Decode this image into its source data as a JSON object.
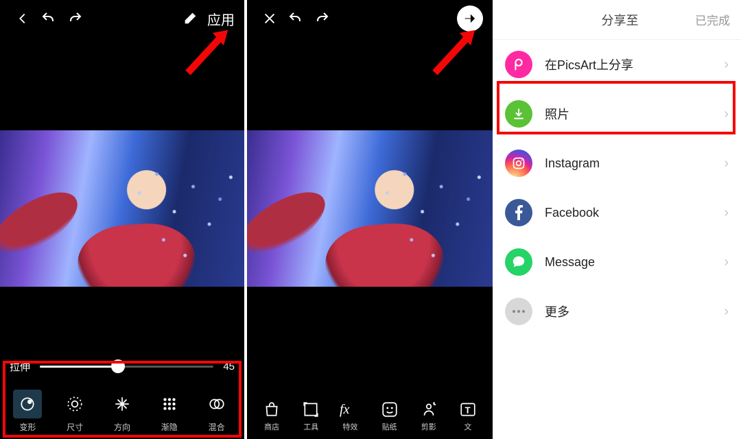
{
  "left": {
    "apply": "应用",
    "slider": {
      "label": "拉伸",
      "value": 45
    },
    "tools": [
      {
        "label": "变形",
        "name": "tool-distort"
      },
      {
        "label": "尺寸",
        "name": "tool-size"
      },
      {
        "label": "方向",
        "name": "tool-direction"
      },
      {
        "label": "渐隐",
        "name": "tool-fade"
      },
      {
        "label": "混合",
        "name": "tool-blend"
      }
    ]
  },
  "mid": {
    "tools": [
      {
        "label": "商店",
        "name": "tool-store"
      },
      {
        "label": "工具",
        "name": "tool-tools"
      },
      {
        "label": "特效",
        "name": "tool-fx"
      },
      {
        "label": "贴纸",
        "name": "tool-sticker"
      },
      {
        "label": "剪影",
        "name": "tool-cutout"
      },
      {
        "label": "文",
        "name": "tool-text"
      }
    ]
  },
  "share": {
    "title": "分享至",
    "done": "已完成",
    "items": [
      {
        "label": "在PicsArt上分享",
        "icon": "picsart"
      },
      {
        "label": "照片",
        "icon": "photos"
      },
      {
        "label": "Instagram",
        "icon": "instagram"
      },
      {
        "label": "Facebook",
        "icon": "facebook"
      },
      {
        "label": "Message",
        "icon": "message"
      },
      {
        "label": "更多",
        "icon": "more"
      }
    ]
  }
}
